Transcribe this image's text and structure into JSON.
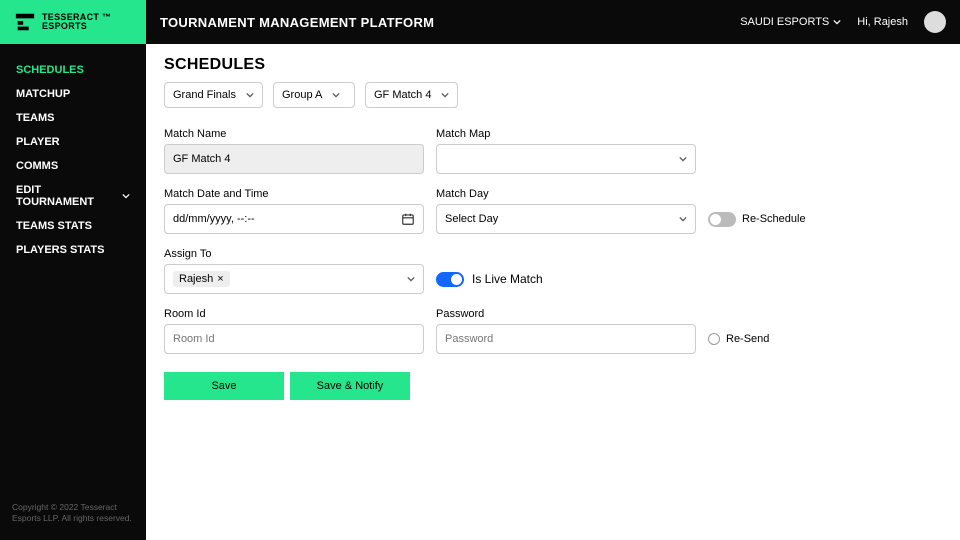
{
  "header": {
    "brand_line1": "TESSERACT ™",
    "brand_line2": "ESPORTS",
    "title": "TOURNAMENT MANAGEMENT PLATFORM",
    "org": "SAUDI ESPORTS",
    "greeting": "Hi, Rajesh"
  },
  "sidebar": {
    "items": [
      {
        "label": "SCHEDULES",
        "active": true
      },
      {
        "label": "MATCHUP"
      },
      {
        "label": "TEAMS"
      },
      {
        "label": "PLAYER"
      },
      {
        "label": "COMMS"
      },
      {
        "label": "EDIT TOURNAMENT",
        "expandable": true
      },
      {
        "label": "TEAMS STATS"
      },
      {
        "label": "PLAYERS STATS"
      }
    ],
    "footer": "Copyright © 2022 Tesseract Esports LLP. All rights reserved."
  },
  "page": {
    "title": "SCHEDULES",
    "filters": {
      "stage": "Grand Finals",
      "group": "Group A",
      "match": "GF Match 4"
    },
    "form": {
      "match_name_label": "Match Name",
      "match_name_value": "GF Match 4",
      "match_map_label": "Match Map",
      "match_map_value": "",
      "datetime_label": "Match Date and Time",
      "datetime_display": "dd/mm/yyyy, --:--",
      "day_label": "Match Day",
      "day_value": "Select Day",
      "reschedule_label": "Re-Schedule",
      "assign_label": "Assign To",
      "assign_chip": "Rajesh",
      "live_label": "Is Live Match",
      "live_on": true,
      "room_label": "Room Id",
      "room_placeholder": "Room Id",
      "password_label": "Password",
      "password_placeholder": "Password",
      "resend_label": "Re-Send",
      "save_label": "Save",
      "save_notify_label": "Save & Notify"
    }
  }
}
